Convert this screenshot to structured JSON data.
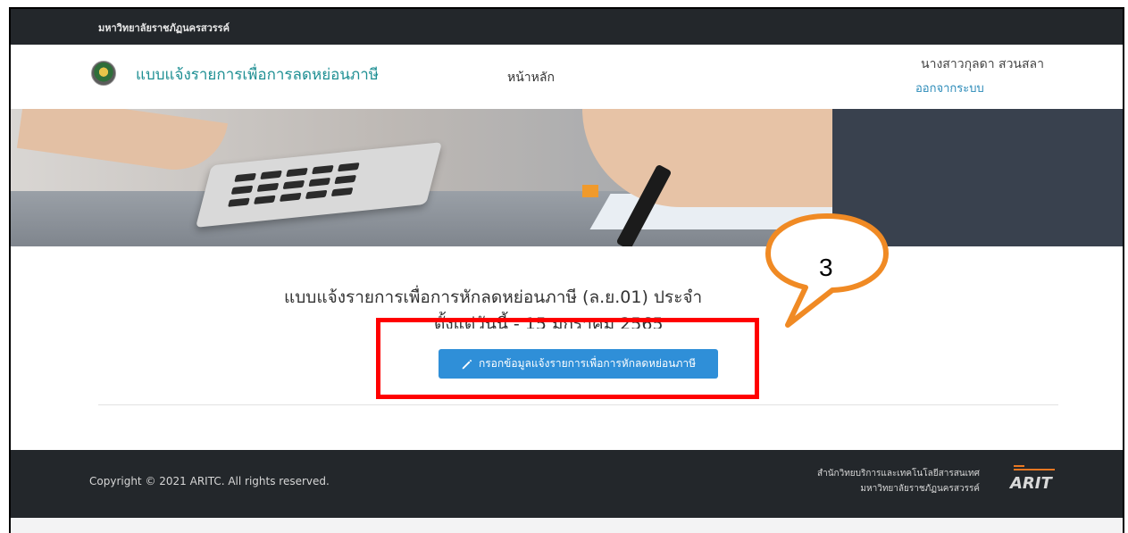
{
  "topbar": {
    "university": "มหาวิทยาลัยราชภัฏนครสวรรค์"
  },
  "navbar": {
    "brand": "แบบแจ้งรายการเพื่อการลดหย่อนภาษี",
    "home_link": "หน้าหลัก",
    "user_name": "นางสาวกุลดา สวนสลา",
    "logout_link": "ออกจากระบบ"
  },
  "main": {
    "heading": "แบบแจ้งรายการเพื่อการหักลดหย่อนภาษี (ล.ย.01) ประจำ",
    "subheading": "ตั้งแต่วันนี้ - 15 มกราคม 2565",
    "fill_button": "กรอกข้อมูลแจ้งรายการเพื่อการหักลดหย่อนภาษี"
  },
  "footer": {
    "copyright": "Copyright © 2021 ARITC. All rights reserved.",
    "office_line1": "สำนักวิทยบริการและเทคโนโลยีสารสนเทศ",
    "office_line2": "มหาวิทยาลัยราชภัฏนครสวรรค์",
    "logo_text": "ARIT"
  },
  "annotation": {
    "step_number": "3",
    "box_color": "#ff0000",
    "callout_color": "#f08a24"
  },
  "colors": {
    "brand": "#1e8f93",
    "button": "#2f8fd8",
    "dark_bar": "#23272b",
    "link": "#2a8ab8"
  },
  "icons": {
    "button_icon": "pencil-icon",
    "logo": "university-seal-icon"
  }
}
